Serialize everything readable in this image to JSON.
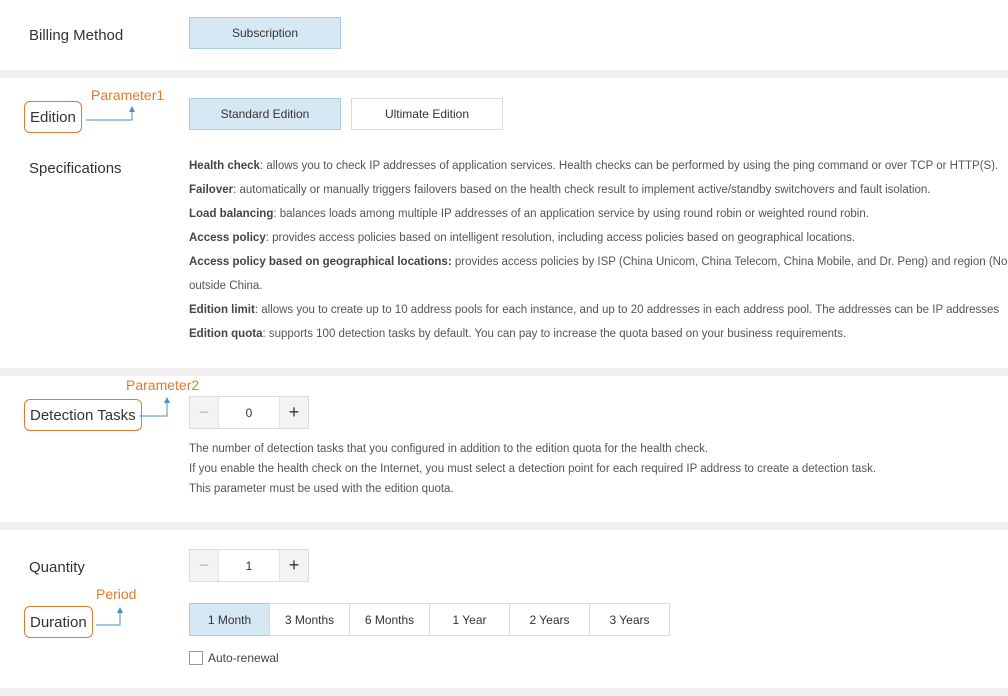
{
  "billing": {
    "label": "Billing Method",
    "options": [
      "Subscription"
    ],
    "selected": "Subscription"
  },
  "edition": {
    "label": "Edition",
    "annotation": "Parameter1",
    "options": [
      {
        "label": "Standard Edition",
        "selected": true
      },
      {
        "label": "Ultimate Edition",
        "selected": false
      }
    ]
  },
  "specifications": {
    "label": "Specifications",
    "lines": [
      {
        "title": "Health check",
        "text": ": allows you to check IP addresses of application services. Health checks can be performed by using the ping command or over TCP or HTTP(S)."
      },
      {
        "title": "Failover",
        "text": ": automatically or manually triggers failovers based on the health check result to implement active/standby switchovers and fault isolation."
      },
      {
        "title": "Load balancing",
        "text": ": balances loads among multiple IP addresses of an application service by using round robin or weighted round robin."
      },
      {
        "title": "Access policy",
        "text": ": provides access policies based on intelligent resolution, including access policies based on geographical locations."
      },
      {
        "title": "Access policy based on geographical locations:",
        "text": " provides access policies by ISP (China Unicom, China Telecom, China Mobile, and Dr. Peng) and region (North"
      },
      {
        "title": "",
        "text": "outside China."
      },
      {
        "title": "Edition limit",
        "text": ": allows you to create up to 10 address pools for each instance, and up to 20 addresses in each address pool. The addresses can be IP addresses"
      },
      {
        "title": "Edition quota",
        "text": ": supports 100 detection tasks by default. You can pay to increase the quota based on your business requirements."
      }
    ]
  },
  "detection": {
    "label": "Detection Tasks",
    "annotation": "Parameter2",
    "value": "0",
    "notes": [
      "The number of detection tasks that you configured in addition to the edition quota for the health check.",
      "If you enable the health check on the Internet, you must select a detection point for each required IP address to create a detection task.",
      "This parameter must be used with the edition quota."
    ]
  },
  "quantity": {
    "label": "Quantity",
    "value": "1"
  },
  "duration": {
    "label": "Duration",
    "annotation": "Period",
    "options": [
      {
        "label": "1 Month",
        "selected": true
      },
      {
        "label": "3 Months",
        "selected": false
      },
      {
        "label": "6 Months",
        "selected": false
      },
      {
        "label": "1 Year",
        "selected": false
      },
      {
        "label": "2 Years",
        "selected": false
      },
      {
        "label": "3 Years",
        "selected": false
      }
    ]
  },
  "auto_renewal": {
    "label": "Auto-renewal",
    "checked": false
  },
  "stepper": {
    "minus": "−",
    "plus": "+"
  },
  "colors": {
    "annotation": "#e07a2e",
    "arrow": "#4a90c8",
    "selected_bg": "#d7e8f5"
  }
}
